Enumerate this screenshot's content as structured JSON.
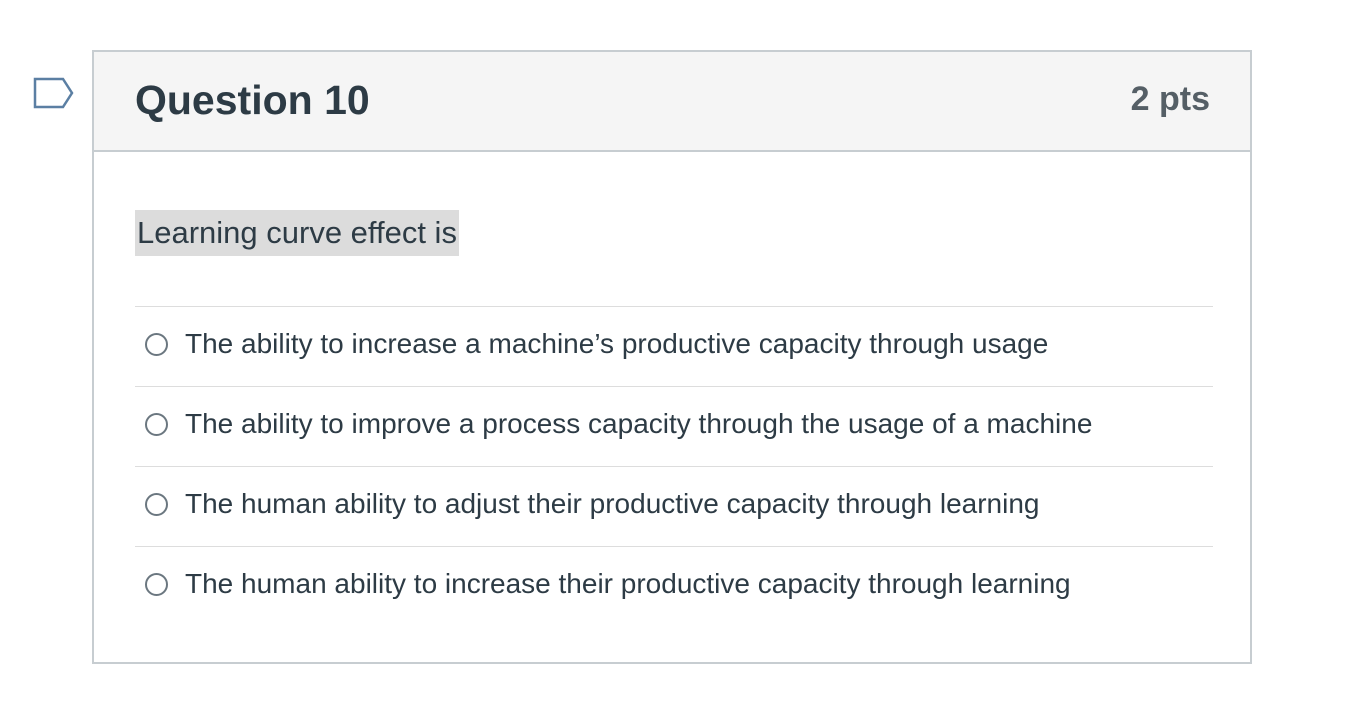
{
  "question": {
    "title": "Question 10",
    "points": "2 pts",
    "text": "Learning curve effect is",
    "flag_icon": "flag-icon",
    "answers": [
      {
        "label": "The ability to increase a machine’s productive capacity through usage",
        "selected": false
      },
      {
        "label": "The ability to improve a process capacity through the usage of a machine",
        "selected": false
      },
      {
        "label": "The human ability to adjust their productive capacity through learning",
        "selected": false
      },
      {
        "label": "The human ability to increase their productive capacity through learning",
        "selected": false
      }
    ]
  },
  "colors": {
    "header_bg": "#f5f5f5",
    "border": "#c7cdd1",
    "question_highlight": "#dcdcdc",
    "text": "#2d3b45",
    "points_text": "#555f66"
  }
}
